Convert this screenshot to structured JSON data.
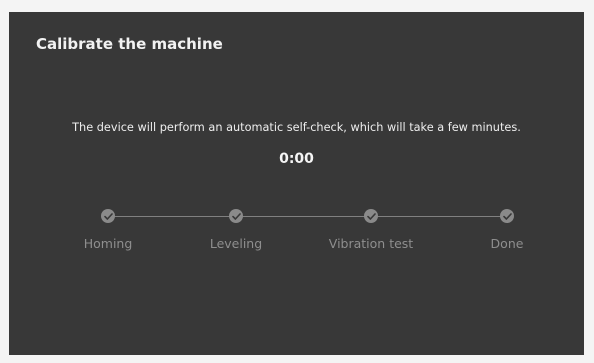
{
  "dialog": {
    "title": "Calibrate the machine",
    "message": "The device will perform an automatic self-check, which will take a few minutes.",
    "timer": "0:00"
  },
  "steps": [
    {
      "label": "Homing",
      "icon": "check-icon"
    },
    {
      "label": "Leveling",
      "icon": "check-icon"
    },
    {
      "label": "Vibration test",
      "icon": "check-icon"
    },
    {
      "label": "Done",
      "icon": "check-icon"
    }
  ],
  "colors": {
    "background": "#383838",
    "title_text": "#f2f2f2",
    "step_inactive": "#8a8a8a",
    "step_label": "#8e8e8e"
  }
}
